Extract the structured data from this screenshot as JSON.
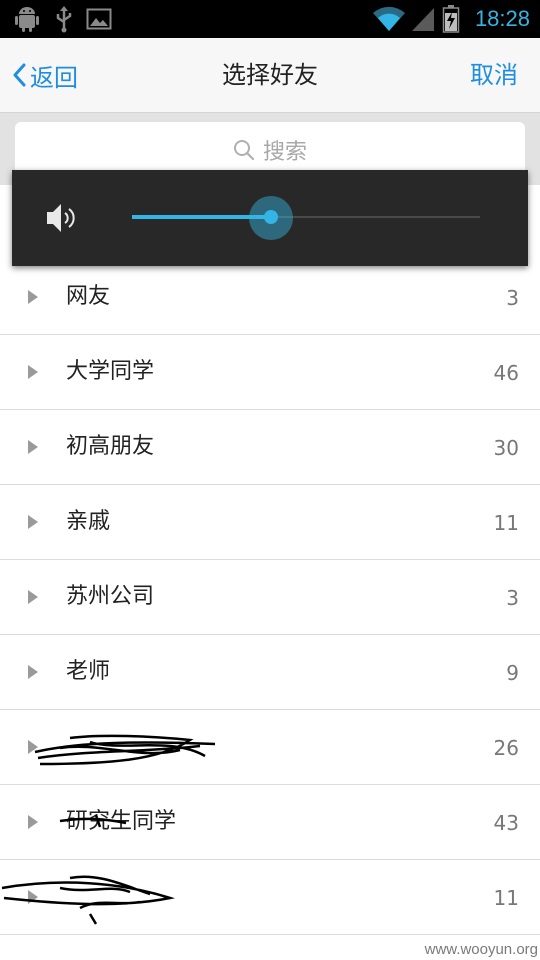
{
  "status_bar": {
    "time": "18:28",
    "left_icons": [
      "android-debug-icon",
      "usb-icon",
      "image-notification-icon"
    ],
    "right_icons": [
      "wifi-icon",
      "signal-icon",
      "battery-charging-icon"
    ],
    "accent_color": "#33b5e5"
  },
  "header": {
    "back_label": "返回",
    "title": "选择好友",
    "cancel_label": "取消",
    "link_color": "#1f8ee0"
  },
  "search": {
    "placeholder": "搜索"
  },
  "volume": {
    "level_fraction": 0.4,
    "accent_color": "#33b5e5"
  },
  "groups": [
    {
      "name": "网友",
      "count": "3"
    },
    {
      "name": "大学同学",
      "count": "46"
    },
    {
      "name": "初高朋友",
      "count": "30"
    },
    {
      "name": "亲戚",
      "count": "11"
    },
    {
      "name": "苏州公司",
      "count": "3"
    },
    {
      "name": "老师",
      "count": "9"
    },
    {
      "name": "",
      "count": "26"
    },
    {
      "name": "研究生同学",
      "count": "43"
    },
    {
      "name": "",
      "count": "11"
    }
  ],
  "watermark": "www.wooyun.org"
}
